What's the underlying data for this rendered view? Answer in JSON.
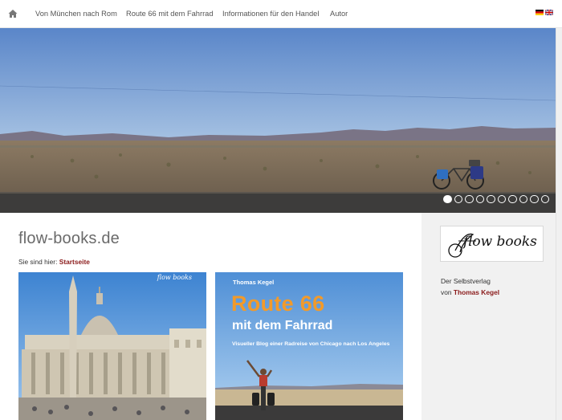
{
  "nav": {
    "items": [
      {
        "label": "Von München nach Rom"
      },
      {
        "label": "Route 66 mit dem Fahrrad"
      },
      {
        "label": "Informationen für den Handel"
      },
      {
        "label": "Autor"
      }
    ],
    "languages": [
      "de",
      "en"
    ]
  },
  "hero": {
    "slide_count": 10,
    "active_slide": 1
  },
  "main": {
    "site_title": "flow-books.de",
    "breadcrumb_prefix": "Sie sind hier:",
    "breadcrumb_current": "Startseite",
    "book1": {
      "logo_text": "flow books"
    },
    "book2": {
      "author": "Thomas Kegel",
      "title_line1": "Route 66",
      "title_line2": "mit dem Fahrrad",
      "subtitle": "Visueller Blog einer Radreise von Chicago nach Los Angeles"
    }
  },
  "sidebar": {
    "logo_text": "flow books",
    "tagline": "Der Selbstverlag",
    "von": "von",
    "author": "Thomas Kegel"
  },
  "colors": {
    "accent": "#8a1a1a",
    "route_orange": "#f29a2a"
  }
}
